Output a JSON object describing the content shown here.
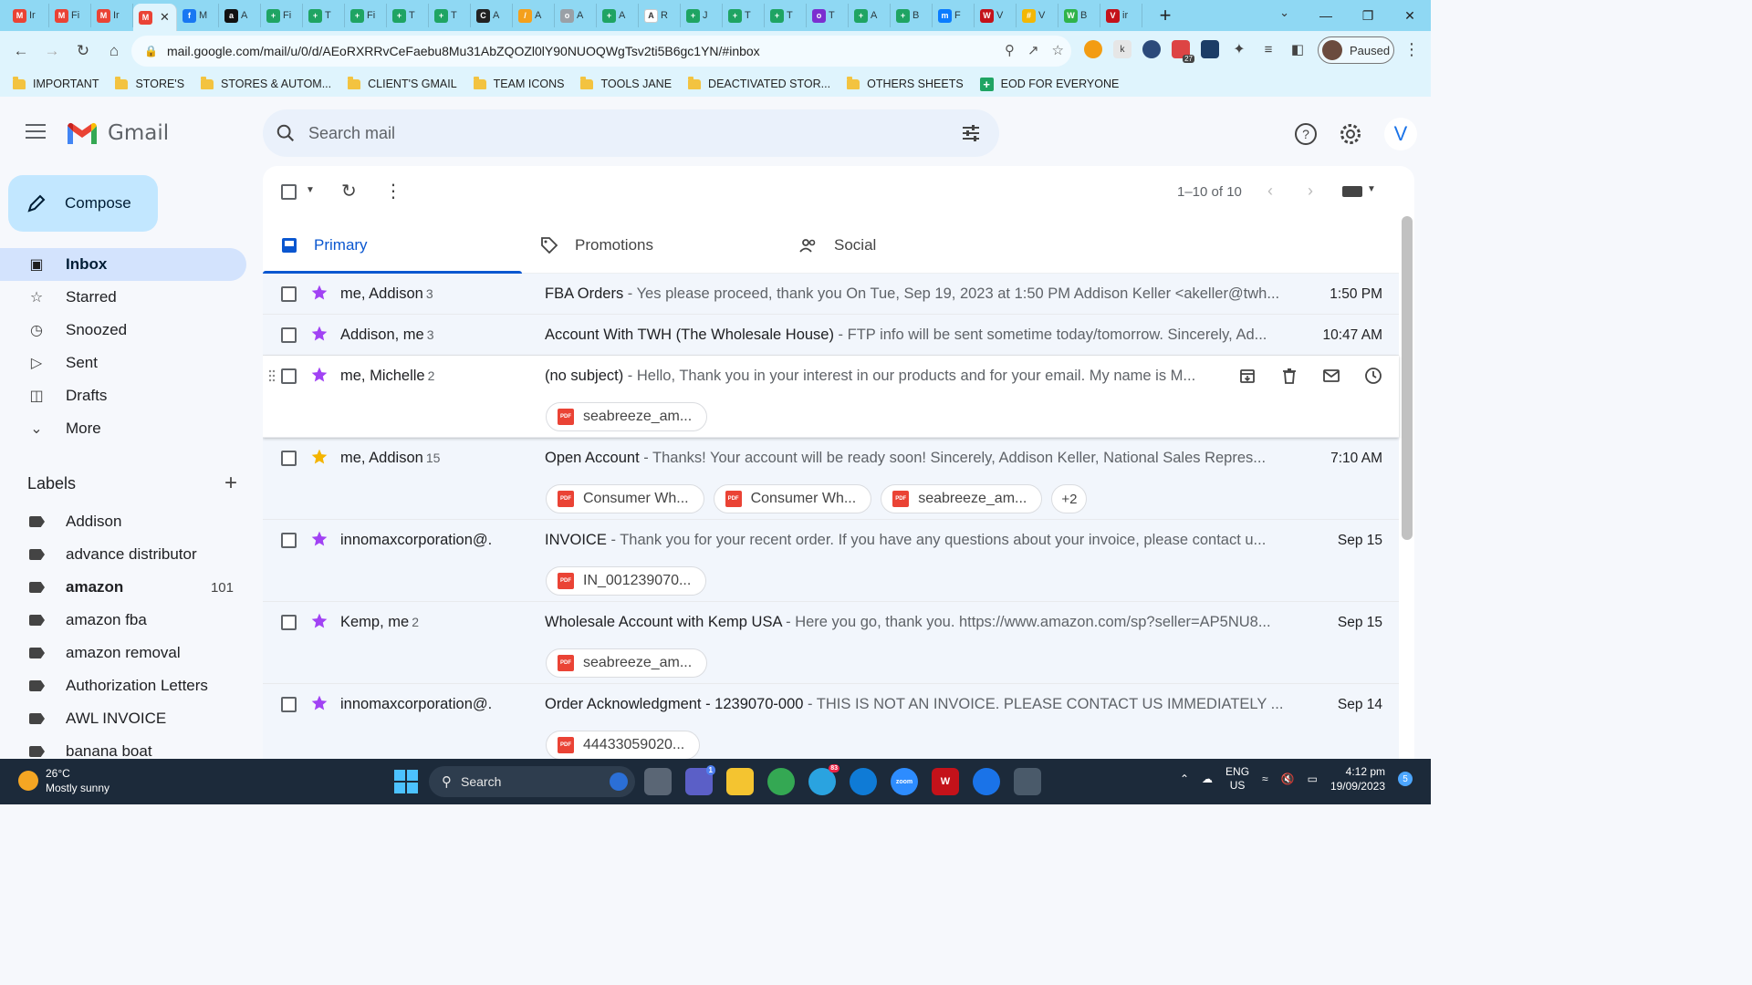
{
  "browser": {
    "tabs": [
      {
        "letter": "Ir",
        "color": "#ea4335",
        "glyph": "M"
      },
      {
        "letter": "Fi",
        "color": "#ea4335",
        "glyph": "M"
      },
      {
        "letter": "Ir",
        "color": "#ea4335",
        "glyph": "M"
      },
      {
        "letter": "",
        "color": "#ea4335",
        "glyph": "M",
        "active": true
      },
      {
        "letter": "M",
        "color": "#1877f2",
        "glyph": "f"
      },
      {
        "letter": "A",
        "color": "#111111",
        "glyph": "a"
      },
      {
        "letter": "Fi",
        "color": "#1fa463",
        "glyph": "+"
      },
      {
        "letter": "T",
        "color": "#1fa463",
        "glyph": "+"
      },
      {
        "letter": "Fi",
        "color": "#1fa463",
        "glyph": "+"
      },
      {
        "letter": "T",
        "color": "#1fa463",
        "glyph": "+"
      },
      {
        "letter": "T",
        "color": "#1fa463",
        "glyph": "+"
      },
      {
        "letter": "A",
        "color": "#222222",
        "glyph": "C"
      },
      {
        "letter": "A",
        "color": "#f4a01c",
        "glyph": "/"
      },
      {
        "letter": "A",
        "color": "#9aa0a6",
        "glyph": "o"
      },
      {
        "letter": "A",
        "color": "#1fa463",
        "glyph": "+"
      },
      {
        "letter": "R",
        "color": "#ffffff",
        "glyph": "A"
      },
      {
        "letter": "J",
        "color": "#1fa463",
        "glyph": "+"
      },
      {
        "letter": "T",
        "color": "#1fa463",
        "glyph": "+"
      },
      {
        "letter": "T",
        "color": "#1fa463",
        "glyph": "+"
      },
      {
        "letter": "T",
        "color": "#7b2fd0",
        "glyph": "o"
      },
      {
        "letter": "A",
        "color": "#1fa463",
        "glyph": "+"
      },
      {
        "letter": "B",
        "color": "#1fa463",
        "glyph": "+"
      },
      {
        "letter": "F",
        "color": "#0a7cff",
        "glyph": "m"
      },
      {
        "letter": "V",
        "color": "#c4121a",
        "glyph": "W"
      },
      {
        "letter": "V",
        "color": "#f2b705",
        "glyph": "#"
      },
      {
        "letter": "B",
        "color": "#2fb34a",
        "glyph": "W"
      },
      {
        "letter": "ir",
        "color": "#c4121a",
        "glyph": "V"
      }
    ],
    "tab_close": "✕",
    "new_tab": "+",
    "window_controls": {
      "tabs_menu": "⌄",
      "minimize": "—",
      "restore": "❐",
      "close": "✕"
    },
    "url": "mail.google.com/mail/u/0/d/AEoRXRRvCeFaebu8Mu31AbZQOZl0lY90NUOQWgTsv2ti5B6gc1YN/#inbox",
    "ext_badge": "27",
    "profile_status": "Paused",
    "bookmarks": [
      {
        "label": "IMPORTANT",
        "type": "folder"
      },
      {
        "label": "STORE'S",
        "type": "folder"
      },
      {
        "label": "STORES & AUTOM...",
        "type": "folder"
      },
      {
        "label": "CLIENT'S GMAIL",
        "type": "folder"
      },
      {
        "label": "TEAM ICONS",
        "type": "folder"
      },
      {
        "label": "TOOLS JANE",
        "type": "folder"
      },
      {
        "label": "DEACTIVATED STOR...",
        "type": "folder"
      },
      {
        "label": "OTHERS SHEETS",
        "type": "folder"
      },
      {
        "label": "EOD FOR EVERYONE",
        "type": "sheet"
      }
    ]
  },
  "gmail": {
    "logo_text": "Gmail",
    "search_placeholder": "Search mail",
    "account_initial": "V",
    "compose_label": "Compose",
    "nav": [
      {
        "label": "Inbox",
        "icon": "inbox-icon",
        "active": true
      },
      {
        "label": "Starred",
        "icon": "star-outline-icon"
      },
      {
        "label": "Snoozed",
        "icon": "clock-icon"
      },
      {
        "label": "Sent",
        "icon": "send-icon"
      },
      {
        "label": "Drafts",
        "icon": "draft-icon"
      },
      {
        "label": "More",
        "icon": "chevron-down-icon"
      }
    ],
    "labels_title": "Labels",
    "labels": [
      {
        "name": "Addison",
        "count": ""
      },
      {
        "name": "advance distributor",
        "count": ""
      },
      {
        "name": "amazon",
        "count": "101",
        "bold": true
      },
      {
        "name": "amazon fba",
        "count": ""
      },
      {
        "name": "amazon removal",
        "count": ""
      },
      {
        "name": "Authorization Letters",
        "count": ""
      },
      {
        "name": "AWL INVOICE",
        "count": ""
      },
      {
        "name": "banana boat",
        "count": ""
      }
    ],
    "pager": "1–10 of 10",
    "tabs": [
      {
        "label": "Primary",
        "icon": "inbox-tab-icon",
        "active": true
      },
      {
        "label": "Promotions",
        "icon": "tag-icon"
      },
      {
        "label": "Social",
        "icon": "people-icon"
      }
    ],
    "emails": [
      {
        "sender": "me, Addison",
        "count": "3",
        "subject": "FBA Orders",
        "snippet": " - Yes please proceed, thank you On Tue, Sep 19, 2023 at 1:50 PM Addison Keller <akeller@twh...",
        "time": "1:50 PM",
        "star": "#a142f4",
        "attachments": [],
        "hover": false
      },
      {
        "sender": "Addison, me",
        "count": "3",
        "subject": "Account With TWH (The Wholesale House)",
        "snippet": " - FTP info will be sent sometime today/tomorrow. Sincerely, Ad...",
        "time": "10:47 AM",
        "star": "#a142f4",
        "attachments": [],
        "hover": false
      },
      {
        "sender": "me, Michelle",
        "count": "2",
        "subject": "(no subject)",
        "snippet": " - Hello, Thank you in your interest in our products and for your email. My name is M...",
        "time": "",
        "star": "#a142f4",
        "attachments": [
          "seabreeze_am..."
        ],
        "hover": true
      },
      {
        "sender": "me, Addison",
        "count": "15",
        "subject": "Open Account",
        "snippet": " - Thanks! Your account will be ready soon! Sincerely, Addison Keller, National Sales Repres...",
        "time": "7:10 AM",
        "star": "#f4b400",
        "attachments": [
          "Consumer Wh...",
          "Consumer Wh...",
          "seabreeze_am..."
        ],
        "more": "+2",
        "hover": false
      },
      {
        "sender": "innomaxcorporation@.",
        "count": "",
        "subject": "INVOICE",
        "snippet": " - Thank you for your recent order. If you have any questions about your invoice, please contact u...",
        "time": "Sep 15",
        "star": "#a142f4",
        "attachments": [
          "IN_001239070..."
        ],
        "hover": false
      },
      {
        "sender": "Kemp, me",
        "count": "2",
        "subject": "Wholesale Account with Kemp USA",
        "snippet": " - Here you go, thank you. https://www.amazon.com/sp?seller=AP5NU8...",
        "time": "Sep 15",
        "star": "#a142f4",
        "attachments": [
          "seabreeze_am..."
        ],
        "hover": false
      },
      {
        "sender": "innomaxcorporation@.",
        "count": "",
        "subject": "Order Acknowledgment - 1239070-000",
        "snippet": " - THIS IS NOT AN INVOICE. PLEASE CONTACT US IMMEDIATELY ...",
        "time": "Sep 14",
        "star": "#a142f4",
        "attachments": [
          "44433059020..."
        ],
        "hover": false
      }
    ],
    "pdf_badge": "PDF"
  },
  "taskbar": {
    "temp": "26°C",
    "weather": "Mostly sunny",
    "search_label": "Search",
    "lang_top": "ENG",
    "lang_bottom": "US",
    "time": "4:12 pm",
    "date": "19/09/2023",
    "notifications": "5",
    "teams_badge": "1",
    "telegram_badge": "83"
  }
}
